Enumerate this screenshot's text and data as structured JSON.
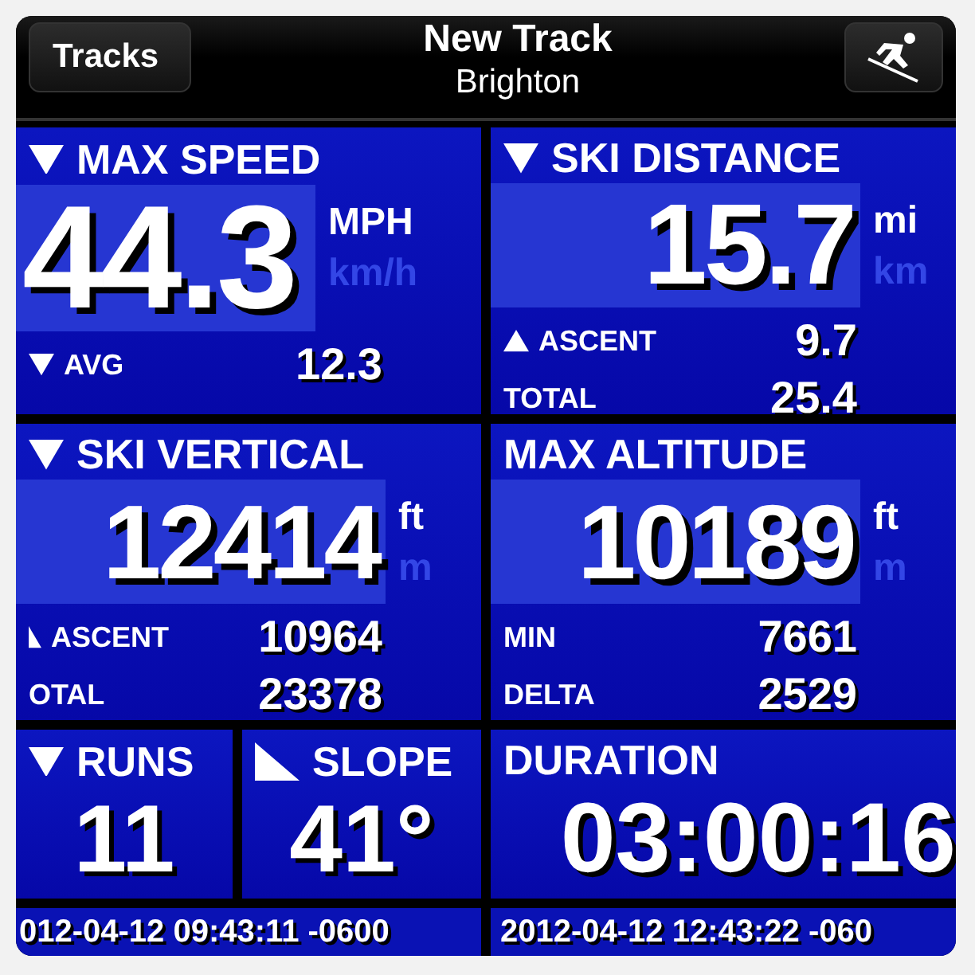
{
  "nav": {
    "back": "Tracks",
    "title": "New Track",
    "subtitle": "Brighton"
  },
  "panels": [
    {
      "title": "MAX SPEED",
      "kind": "down",
      "value": "44.3",
      "units": [
        {
          "label": "MPH",
          "selected": true
        },
        {
          "label": "km/h",
          "selected": false
        }
      ],
      "rows": [
        {
          "label": "AVG",
          "kind": "down",
          "value": "12.3"
        }
      ]
    },
    {
      "title": "SKI DISTANCE",
      "kind": "down",
      "value": "15.7",
      "units": [
        {
          "label": "mi",
          "selected": true
        },
        {
          "label": "km",
          "selected": false
        }
      ],
      "rows": [
        {
          "label": "ASCENT",
          "kind": "up",
          "value": "9.7"
        },
        {
          "label": "TOTAL",
          "kind": "plain",
          "value": "25.4"
        }
      ]
    },
    {
      "title": "SKI VERTICAL",
      "kind": "down",
      "value": "12414",
      "units": [
        {
          "label": "ft",
          "selected": true
        },
        {
          "label": "m",
          "selected": false
        }
      ],
      "rows": [
        {
          "label": "ASCENT",
          "kind": "upcut",
          "value": "10964"
        },
        {
          "label": "OTAL",
          "kind": "plain",
          "value": "23378"
        }
      ]
    },
    {
      "title": "MAX ALTITUDE",
      "kind": "plain",
      "value": "10189",
      "units": [
        {
          "label": "ft",
          "selected": true
        },
        {
          "label": "m",
          "selected": false
        }
      ],
      "rows": [
        {
          "label": "MIN",
          "kind": "plain",
          "value": "7661"
        },
        {
          "label": "DELTA",
          "kind": "plain",
          "value": "2529"
        }
      ]
    }
  ],
  "small_panels": [
    {
      "title": "RUNS",
      "kind": "down",
      "value": "11"
    },
    {
      "title": "SLOPE",
      "kind": "slope",
      "value": "41°"
    },
    {
      "title": "DURATION",
      "kind": "plain",
      "value": "03:00:16"
    }
  ],
  "footer": [
    "012-04-12 09:43:11 -0600",
    "2012-04-12 12:43:22 -060"
  ]
}
